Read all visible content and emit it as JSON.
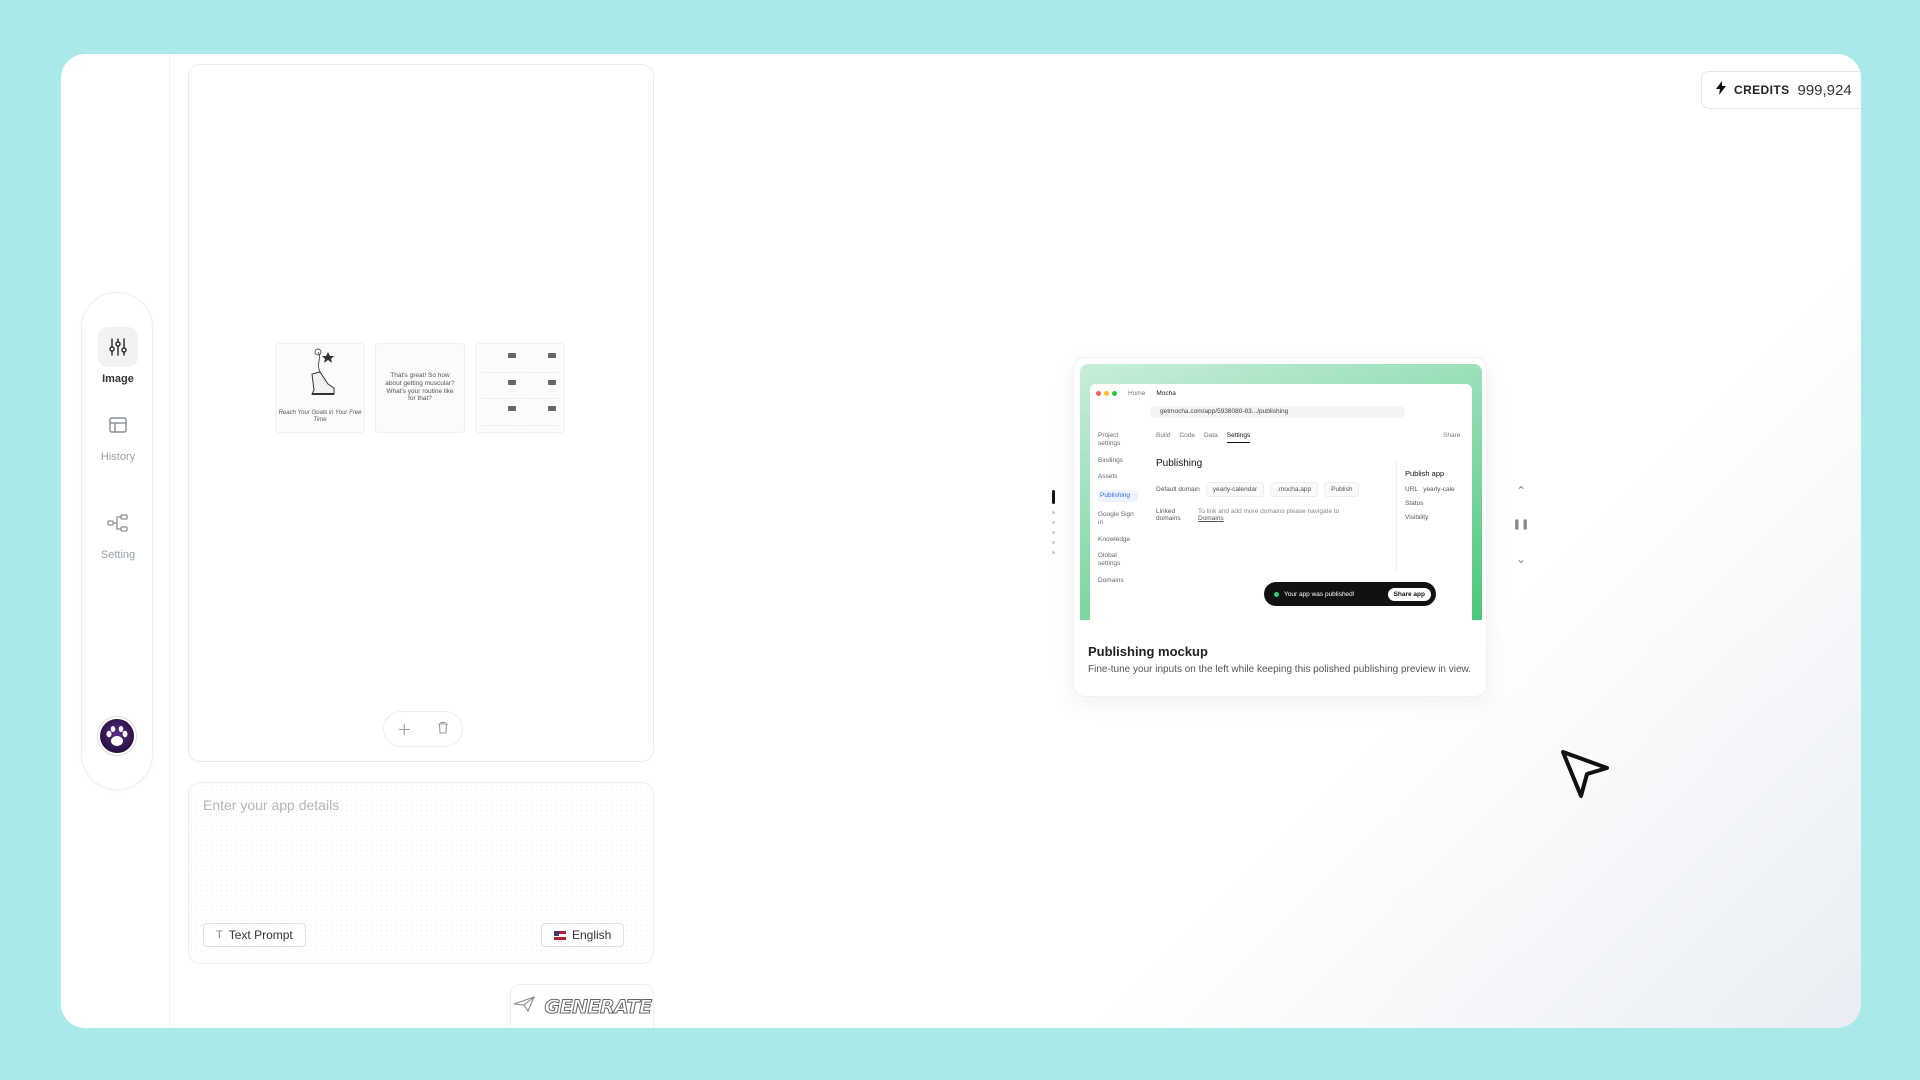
{
  "sidebar": {
    "items": [
      {
        "label": "Image",
        "icon": "sliders-icon",
        "active": true
      },
      {
        "label": "History",
        "icon": "layout-icon",
        "active": false
      },
      {
        "label": "Setting",
        "icon": "share-nodes-icon",
        "active": false
      }
    ]
  },
  "preview": {
    "thumb1_caption": "Reach Your Goals in Your Free Time",
    "thumb2_text": "That's great! So how about getting muscular? What's your routine like for that?"
  },
  "prompt": {
    "placeholder": "Enter your app details",
    "text_prompt_label": "Text Prompt",
    "language_label": "English"
  },
  "generate": {
    "label": "GENERATE"
  },
  "credits": {
    "label": "CREDITS",
    "value": "999,924"
  },
  "card": {
    "title": "Publishing mockup",
    "description": "Fine-tune your inputs on the left while keeping this polished publishing preview in view.",
    "mock": {
      "tab_home": "Home",
      "tab_mocha": "Mocha",
      "url": "getmocha.com/app/5938080-83.../publishing",
      "nav": [
        "Project settings",
        "Bindings",
        "Assets",
        "Publishing",
        "Google Sign in",
        "Knowledge",
        "Global settings",
        "Domains"
      ],
      "tabs": [
        "Build",
        "Code",
        "Data",
        "Settings"
      ],
      "share": "Share",
      "heading": "Publishing",
      "default_domain_label": "Default domain",
      "domain_value": "yearly-calendar",
      "domain_suffix": ".mocha.app",
      "publish_label": "Publish",
      "linked_domains_label": "Linked domains",
      "linked_domains_text": "To link and add more domains please navigate to",
      "domains_link": "Domains",
      "side_title": "Publish app",
      "side_url": "URL",
      "side_url_value": "yearly-cale",
      "side_status": "Status",
      "side_visibility": "Visibility",
      "toast": "Your app was published!",
      "toast_button": "Share app"
    }
  }
}
